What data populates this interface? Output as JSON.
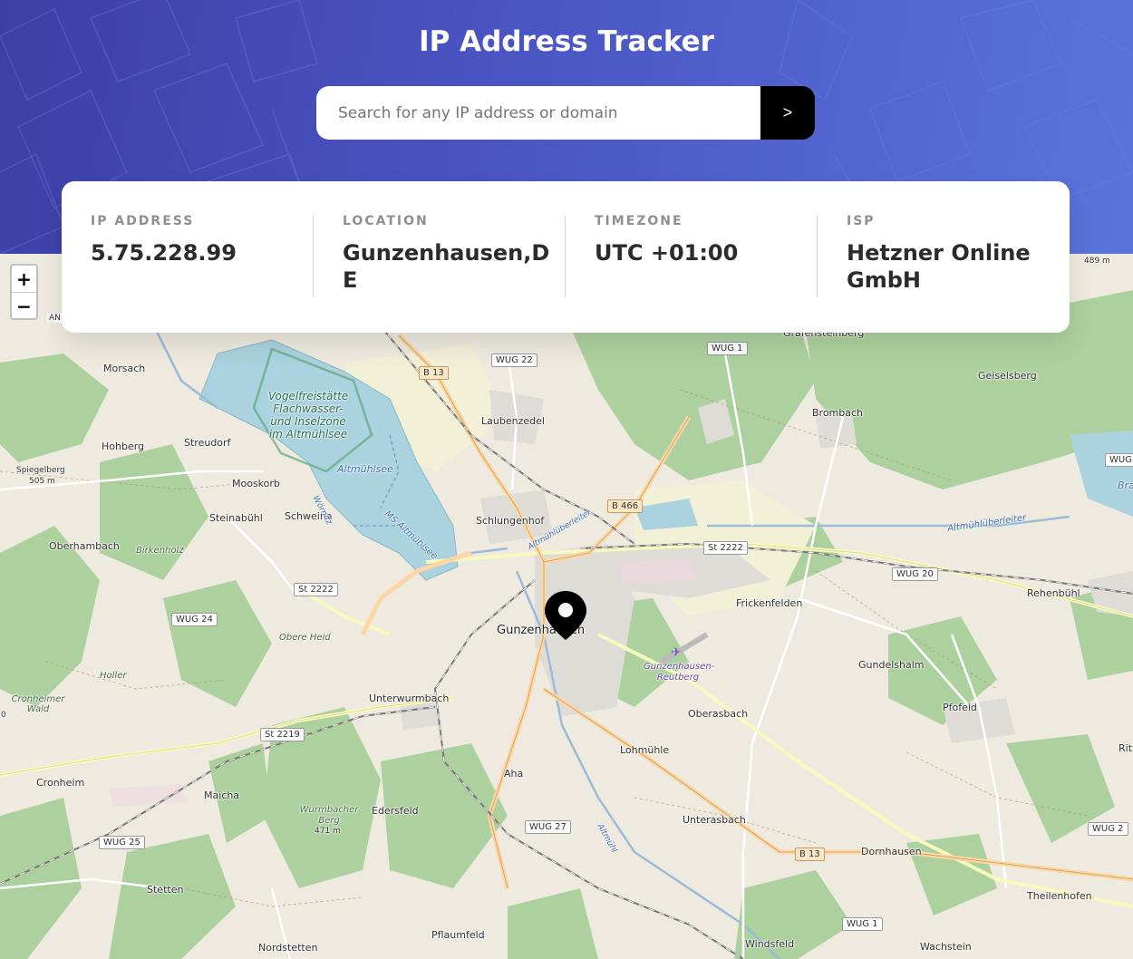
{
  "header": {
    "title": "IP Address Tracker",
    "search": {
      "placeholder": "Search for any IP address or domain",
      "value": "",
      "button_label": ">"
    }
  },
  "stats": [
    {
      "label": "IP ADDRESS",
      "value": "5.75.228.99"
    },
    {
      "label": "LOCATION",
      "value": "Gunzenhausen,DE"
    },
    {
      "label": "TIMEZONE",
      "value": "UTC +01:00"
    },
    {
      "label": "ISP",
      "value": "Hetzner Online GmbH"
    }
  ],
  "map": {
    "zoom_in_label": "+",
    "zoom_out_label": "−",
    "places": {
      "morsach": "Morsach",
      "hohberg": "Hohberg",
      "streudorf": "Streudorf",
      "spiegelberg": "Spiegelberg",
      "spiegelberg_ele": "505 m",
      "mooskorb": "Mooskorb",
      "steinabuhl": "Steinabühl",
      "schweina": "Schweina",
      "oberhambach": "Oberhambach",
      "birkenholz": "Birkenholz",
      "laubenzedel": "Laubenzedel",
      "schlungenhof": "Schlungenhof",
      "brombach": "Brombach",
      "geiselsberg": "Geiselsberg",
      "grafensteinberg": "Grafensteinberg",
      "gunzenhausen": "Gunzenhausen",
      "frickenfelden": "Frickenfelden",
      "rehenbuhl": "Rehenbühl",
      "gundelshalm": "Gundelshalm",
      "pfofeld": "Pfofeld",
      "oberasbach": "Oberasbach",
      "lohmuhle": "Lohmühle",
      "unterwurmbach": "Unterwurmbach",
      "obere_heid": "Obere Heid",
      "holler": "Holler",
      "cronheimer_wald": "Cronheimer Wald",
      "cronheim": "Cronheim",
      "maicha": "Maicha",
      "aha": "Aha",
      "edersfeld": "Edersfeld",
      "wurmbacher_berg": "Wurmbacher Berg",
      "wurmbacher_ele": "471 m",
      "unterasbach": "Unterasbach",
      "dornhausen": "Dornhausen",
      "theilenhofen": "Theilenhofen",
      "stetten": "Stetten",
      "pflaumfeld": "Pflaumfeld",
      "nordstetten": "Nordstetten",
      "windsfeld": "Windsfeld",
      "wachstein": "Wachstein",
      "ritt": "Rit",
      "bra": "Bra",
      "elev_489": "489 m",
      "an": "AN",
      "zero": "0"
    },
    "water": {
      "altmuhlsee": "Altmühlsee",
      "ms_altmuhlsee": "MS Altmühlsee",
      "wornitz": "Wörnitz",
      "altmuhl_ueberleiter": "Altmühlüberleiter",
      "altmuhl_river": "Altmühl"
    },
    "protected_area": "Vogelfreistätte Flachwasser- und Inselzone im Altmühlsee",
    "airport": "Gunzenhausen-Reutberg",
    "roads": {
      "b13_north": "B 13",
      "wug22": "WUG 22",
      "wug1_north": "WUG 1",
      "b466": "B 466",
      "st2222_east": "St 2222",
      "wug20": "WUG 20",
      "st2222_west": "St 2222",
      "wug24": "WUG 24",
      "st2219": "St 2219",
      "wug25": "WUG 25",
      "wug27": "WUG 27",
      "b13_south": "B 13",
      "wug2": "WUG 2",
      "wug1_south": "WUG 1",
      "wug_edge": "WUG"
    }
  }
}
